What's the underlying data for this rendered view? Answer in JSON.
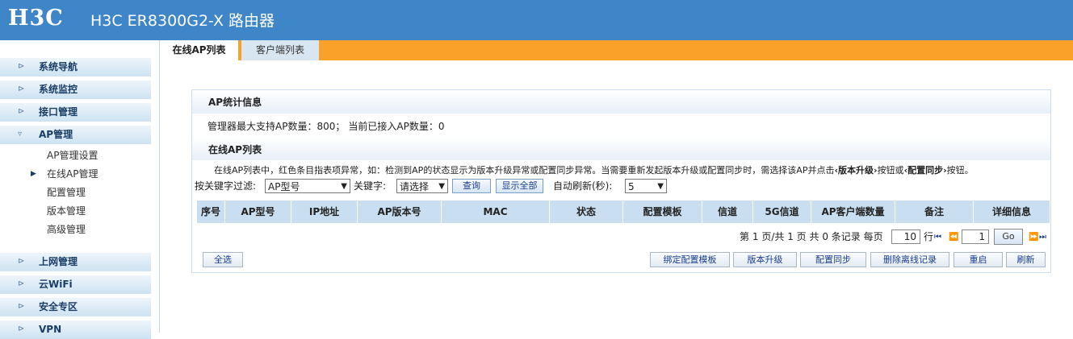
{
  "header": {
    "logo": "H3C",
    "title": "H3C ER8300G2-X 路由器"
  },
  "tabs": [
    {
      "label": "在线AP列表",
      "active": true
    },
    {
      "label": "客户端列表",
      "active": false
    }
  ],
  "sidebar": {
    "items": [
      {
        "label": "系统导航",
        "icon": "expand-icon"
      },
      {
        "label": "系统监控",
        "icon": "expand-icon"
      },
      {
        "label": "接口管理",
        "icon": "expand-icon"
      },
      {
        "label": "AP管理",
        "icon": "collapse-icon",
        "expanded": true
      },
      {
        "label": "上网管理",
        "icon": "expand-icon"
      },
      {
        "label": "云WiFi",
        "icon": "expand-icon"
      },
      {
        "label": "安全专区",
        "icon": "expand-icon"
      },
      {
        "label": "VPN",
        "icon": "expand-icon"
      }
    ],
    "subitems": [
      {
        "label": "AP管理设置"
      },
      {
        "label": "在线AP管理",
        "selected": true
      },
      {
        "label": "配置管理"
      },
      {
        "label": "版本管理"
      },
      {
        "label": "高级管理"
      }
    ]
  },
  "stats": {
    "title": "AP统计信息",
    "max_label": "管理器最大支持AP数量：",
    "max_value": "800",
    "sep": "；",
    "current_label": "当前已接入AP数量：",
    "current_value": "0"
  },
  "list": {
    "title": "在线AP列表",
    "note_pre": "在线AP列表中，红色条目指表项异常，如：检测到AP的状态显示为版本升级异常或配置同步异常。当需要重新发起版本升级或配置同步时，需选择该AP并点击",
    "note_b1": "‹版本升级›",
    "note_mid": "按钮或",
    "note_b2": "‹配置同步›",
    "note_end": "按钮。"
  },
  "filter": {
    "label": "按关键字过滤:",
    "field_value": "AP型号",
    "keyword_label": "关键字:",
    "keyword_value": "请选择",
    "query_button": "查询",
    "show_all_button": "显示全部",
    "refresh_label": "自动刷新(秒):",
    "refresh_value": "5"
  },
  "table": {
    "columns": [
      "序号",
      "AP型号",
      "IP地址",
      "AP版本号",
      "MAC",
      "状态",
      "配置模板",
      "信道",
      "5G信道",
      "AP客户端数量",
      "备注",
      "详细信息"
    ],
    "rows": []
  },
  "pagination": {
    "page_prefix": "第",
    "current_page": "1",
    "page_mid": "页/共",
    "total_pages": "1",
    "page_mid2": "页 共",
    "total_records": "0",
    "records_suffix": "条记录",
    "per_page_label": "每页",
    "per_page_value": "10",
    "rows_label": "行",
    "goto_value": "1",
    "go_button": "Go"
  },
  "actions": {
    "select_all": "全选",
    "bind_template": "绑定配置模板",
    "upgrade": "版本升级",
    "sync": "配置同步",
    "delete_offline": "删除离线记录",
    "restart": "重启",
    "refresh": "刷新"
  },
  "colors": {
    "header_blue": "#3f86c8",
    "tab_orange": "#f9a128",
    "table_header": "#c9dff1"
  }
}
